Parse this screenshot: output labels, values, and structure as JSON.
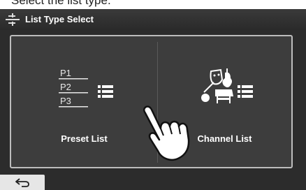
{
  "caption": {
    "text": "Select the list type."
  },
  "header": {
    "title": "List Type Select",
    "icon": "list-type-icon"
  },
  "options": [
    {
      "label": "Preset List",
      "icon": "preset-list-icon",
      "preset_labels": [
        "P1",
        "P2",
        "P3"
      ]
    },
    {
      "label": "Channel List",
      "icon": "channel-list-icon"
    }
  ],
  "footer": {
    "back_icon": "return-arrow-icon"
  },
  "colors": {
    "background": "#2c2c2c",
    "panel": "#3d3d3d",
    "panel_border": "#bdbdbd",
    "text": "#ffffff",
    "back_button": "#e6e6e6"
  }
}
